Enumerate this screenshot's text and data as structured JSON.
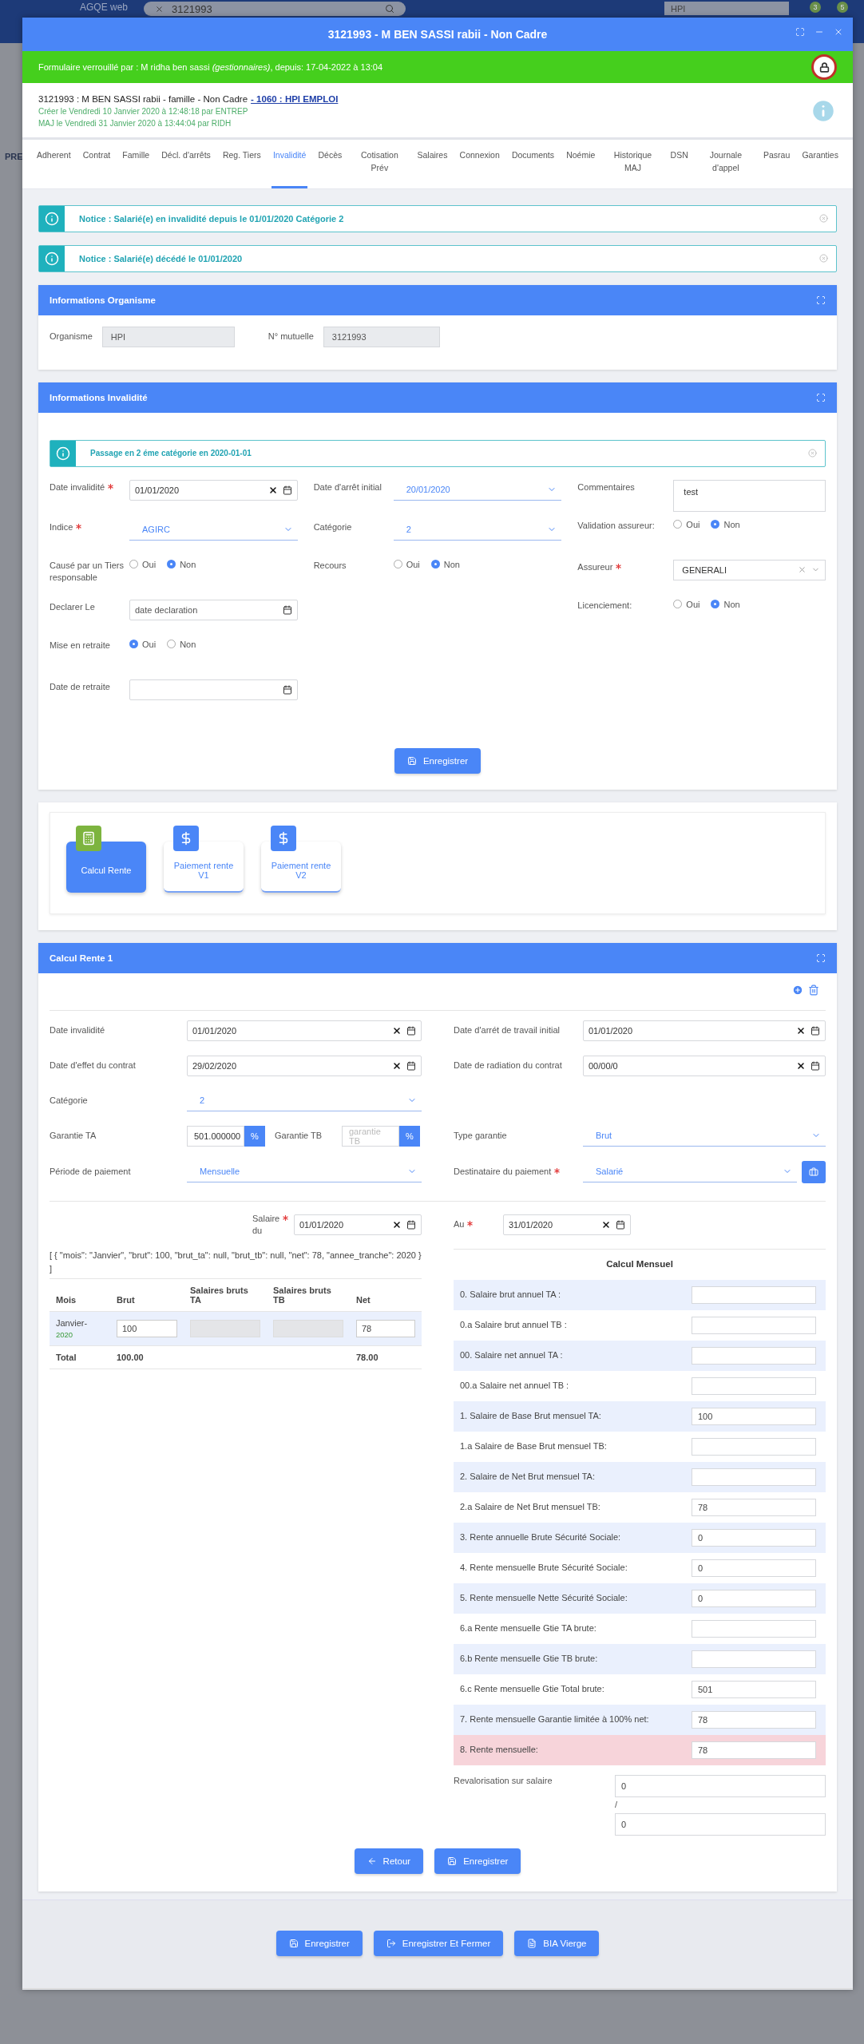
{
  "app": {
    "logo": "AGQE web",
    "search": "3121993",
    "site": "HPI",
    "sidebar_heading": "PRE",
    "badges": [
      "3",
      "5"
    ]
  },
  "window": {
    "title": "3121993 - M BEN SASSI rabii - Non Cadre"
  },
  "lock_banner": {
    "text": "Formulaire verrouillé par : M ridha ben sassi *(gestionnaires)*, depuis: 17-04-2022 à 13:04",
    "locked": true
  },
  "header": {
    "title": "3121993 : M BEN SASSI rabii - famille - Non Cadre",
    "link": "- 1060 : HPI EMPLOI",
    "created": "Créer le Vendredi 10 Janvier 2020 à 12:48:18 par ENTREP",
    "updated": "MAJ le Vendredi 31 Janvier 2020 à 13:44:04 par RIDH"
  },
  "tabs": [
    {
      "label": "Adherent",
      "selected": false
    },
    {
      "label": "Contrat",
      "selected": false
    },
    {
      "label": "Famille",
      "selected": false
    },
    {
      "label": "Décl. d'arrêts",
      "selected": false
    },
    {
      "label": "Reg. Tiers",
      "selected": false
    },
    {
      "label": "Invalidité",
      "selected": true
    },
    {
      "label": "Décès",
      "selected": false
    },
    {
      "label": "Cotisation Prév",
      "selected": false
    },
    {
      "label": "Salaires",
      "selected": false
    },
    {
      "label": "Connexion",
      "selected": false
    },
    {
      "label": "Documents",
      "selected": false
    },
    {
      "label": "Noémie",
      "selected": false
    },
    {
      "label": "Historique MAJ",
      "selected": false
    },
    {
      "label": "DSN",
      "selected": false
    },
    {
      "label": "Journale d'appel",
      "selected": false
    },
    {
      "label": "Pasrau",
      "selected": false
    },
    {
      "label": "Garanties",
      "selected": false
    }
  ],
  "notices": [
    "Notice : Salarié(e) en invalidité depuis le 01/01/2020 Catégorie 2",
    "Notice : Salarié(e) décédé le 01/01/2020"
  ],
  "organisme": {
    "title": "Informations Organisme",
    "fields": [
      {
        "label": "Organisme",
        "value": "HPI"
      },
      {
        "label": "N° mutuelle",
        "value": "3121993"
      }
    ]
  },
  "invalidite": {
    "title": "Informations Invalidité",
    "notice": "Passage en 2 éme catégorie en 2020-01-01",
    "columns": [
      [
        {
          "kind": "date",
          "label": "Date invalidité",
          "required": true,
          "value": "01/01/2020",
          "clearable": true
        },
        {
          "kind": "select",
          "label": "Indice",
          "required": true,
          "value": "AGIRC"
        },
        {
          "kind": "radio",
          "label": "Causé par un Tiers responsable",
          "required": false,
          "options": [
            {
              "label": "Oui",
              "selected": false
            },
            {
              "label": "Non",
              "selected": true
            }
          ]
        },
        {
          "kind": "date",
          "label": "Declarer Le",
          "required": false,
          "placeholder": "date declaration",
          "clearable": false
        },
        {
          "kind": "radio",
          "label": "Mise en retraite",
          "required": false,
          "options": [
            {
              "label": "Oui",
              "selected": true
            },
            {
              "label": "Non",
              "selected": false
            }
          ]
        },
        {
          "kind": "date",
          "label": "Date de retraite",
          "required": false,
          "clearable": false
        }
      ],
      [
        {
          "kind": "select",
          "label": "Date d'arrêt initial",
          "required": false,
          "value": "20/01/2020"
        },
        {
          "kind": "select",
          "label": "Catégorie",
          "required": false,
          "value": "2"
        },
        {
          "kind": "radio",
          "label": "Recours",
          "required": false,
          "options": [
            {
              "label": "Oui",
              "selected": false
            },
            {
              "label": "Non",
              "selected": true
            }
          ]
        }
      ],
      [
        {
          "kind": "textarea",
          "label": "Commentaires",
          "required": false,
          "value": "test"
        },
        {
          "kind": "radio",
          "label": "Validation assureur:",
          "required": false,
          "options": [
            {
              "label": "Oui",
              "selected": false
            },
            {
              "label": "Non",
              "selected": true
            }
          ]
        },
        {
          "kind": "combo",
          "label": "Assureur",
          "required": true,
          "value": "GENERALI"
        },
        {
          "kind": "radio",
          "label": "Licenciement:",
          "required": false,
          "options": [
            {
              "label": "Oui",
              "selected": false
            },
            {
              "label": "Non",
              "selected": true
            }
          ]
        }
      ]
    ],
    "save": "Enregistrer"
  },
  "rente_cards": [
    {
      "label": "Calcul Rente",
      "kind": "calculator",
      "selected": true
    },
    {
      "label": "Paiement rente V1",
      "kind": "money",
      "selected": false
    },
    {
      "label": "Paiement rente V2",
      "kind": "money",
      "selected": false
    }
  ],
  "calcul_rente": {
    "title": "Calcul Rente 1",
    "rows": [
      [
        {
          "kind": "date",
          "label": "Date invalidité",
          "required": false,
          "value": "01/01/2020",
          "clearable": true
        },
        {
          "kind": "date",
          "label": "Date d'arrét de travail initial",
          "required": false,
          "value": "01/01/2020",
          "clearable": true
        }
      ],
      [
        {
          "kind": "date",
          "label": "Date d'effet du contrat",
          "required": false,
          "value": "29/02/2020",
          "clearable": true
        },
        {
          "kind": "date",
          "label": "Date de radiation du contrat",
          "required": false,
          "value": "00/00/0",
          "clearable": true
        }
      ],
      [
        {
          "kind": "select",
          "label": "Catégorie",
          "required": false,
          "value": "2"
        }
      ],
      [
        {
          "kind": "percent",
          "label": "Garantie TA",
          "required": false,
          "value": "501.000000",
          "unit": "%"
        },
        {
          "kind": "percent",
          "label": "Garantie TB",
          "required": false,
          "placeholder": "garantie TB",
          "unit": "%"
        },
        {
          "kind": "select",
          "label": "Type garantie",
          "required": false,
          "value": "Brut"
        }
      ],
      [
        {
          "kind": "select",
          "label": "Période de paiement",
          "required": false,
          "value": "Mensuelle"
        },
        {
          "kind": "select_button",
          "label": "Destinataire du paiement",
          "required": true,
          "value": "Salarié"
        }
      ]
    ],
    "salary_from": {
      "label": "Salaire du",
      "required": true,
      "value": "01/01/2020"
    },
    "salary_to": {
      "label": "Au",
      "required": true,
      "value": "31/01/2020"
    },
    "json_text": "[ { \"mois\": \"Janvier\", \"brut\": 100, \"brut_ta\": null, \"brut_tb\": null, \"net\": 78, \"annee_tranche\": 2020 } ]",
    "table": {
      "columns": [
        "Mois",
        "Brut",
        "Salaires bruts TA",
        "Salaires bruts TB",
        "Net"
      ],
      "rows": [
        {
          "month": "Janvier-",
          "year": "2020",
          "brut": "100",
          "net": "78"
        }
      ],
      "total": {
        "label": "Total",
        "brut": "100.00",
        "net": "78.00"
      }
    },
    "monthly": {
      "title": "Calcul Mensuel",
      "rows": [
        {
          "label": "0. Salaire brut annuel TA :",
          "alert": false
        },
        {
          "label": "0.a Salaire brut annuel TB :",
          "alert": false
        },
        {
          "label": "00. Salaire net annuel TA :",
          "alert": false
        },
        {
          "label": "00.a Salaire net annuel TB :",
          "alert": false
        },
        {
          "label": "1. Salaire de Base Brut mensuel TA:",
          "value": "100",
          "alert": false
        },
        {
          "label": "1.a Salaire de Base Brut mensuel TB:",
          "alert": false
        },
        {
          "label": "2. Salaire de Net Brut mensuel TA:",
          "alert": false
        },
        {
          "label": "2.a Salaire de Net Brut mensuel TB:",
          "value": "78",
          "alert": false
        },
        {
          "label": "3. Rente annuelle Brute Sécurité Sociale:",
          "value": "0",
          "alert": false
        },
        {
          "label": "4. Rente mensuelle Brute Sécurité Sociale:",
          "value": "0",
          "alert": false
        },
        {
          "label": "5. Rente mensuelle Nette Sécurité Sociale:",
          "value": "0",
          "alert": false
        },
        {
          "label": "6.a Rente mensuelle Gtie TA brute:",
          "alert": false
        },
        {
          "label": "6.b Rente mensuelle Gtie TB brute:",
          "alert": false
        },
        {
          "label": "6.c Rente mensuelle Gtie Total brute:",
          "value": "501",
          "alert": false
        },
        {
          "label": "7. Rente mensuelle Garantie limitée à 100% net:",
          "value": "78",
          "alert": false
        },
        {
          "label": "8. Rente mensuelle:",
          "value": "78",
          "alert": true
        }
      ]
    },
    "revalorisation": {
      "label": "Revalorisation sur salaire",
      "value": "0",
      "separator": "/",
      "value_2": "0"
    },
    "buttons": [
      {
        "label": "Retour",
        "kind": "back"
      },
      {
        "label": "Enregistrer",
        "kind": "save"
      }
    ]
  },
  "footer_buttons": [
    {
      "label": "Enregistrer",
      "kind": "save"
    },
    {
      "label": "Enregistrer Et Fermer",
      "kind": "save_close"
    },
    {
      "label": "BIA Vierge",
      "kind": "pdf"
    }
  ]
}
